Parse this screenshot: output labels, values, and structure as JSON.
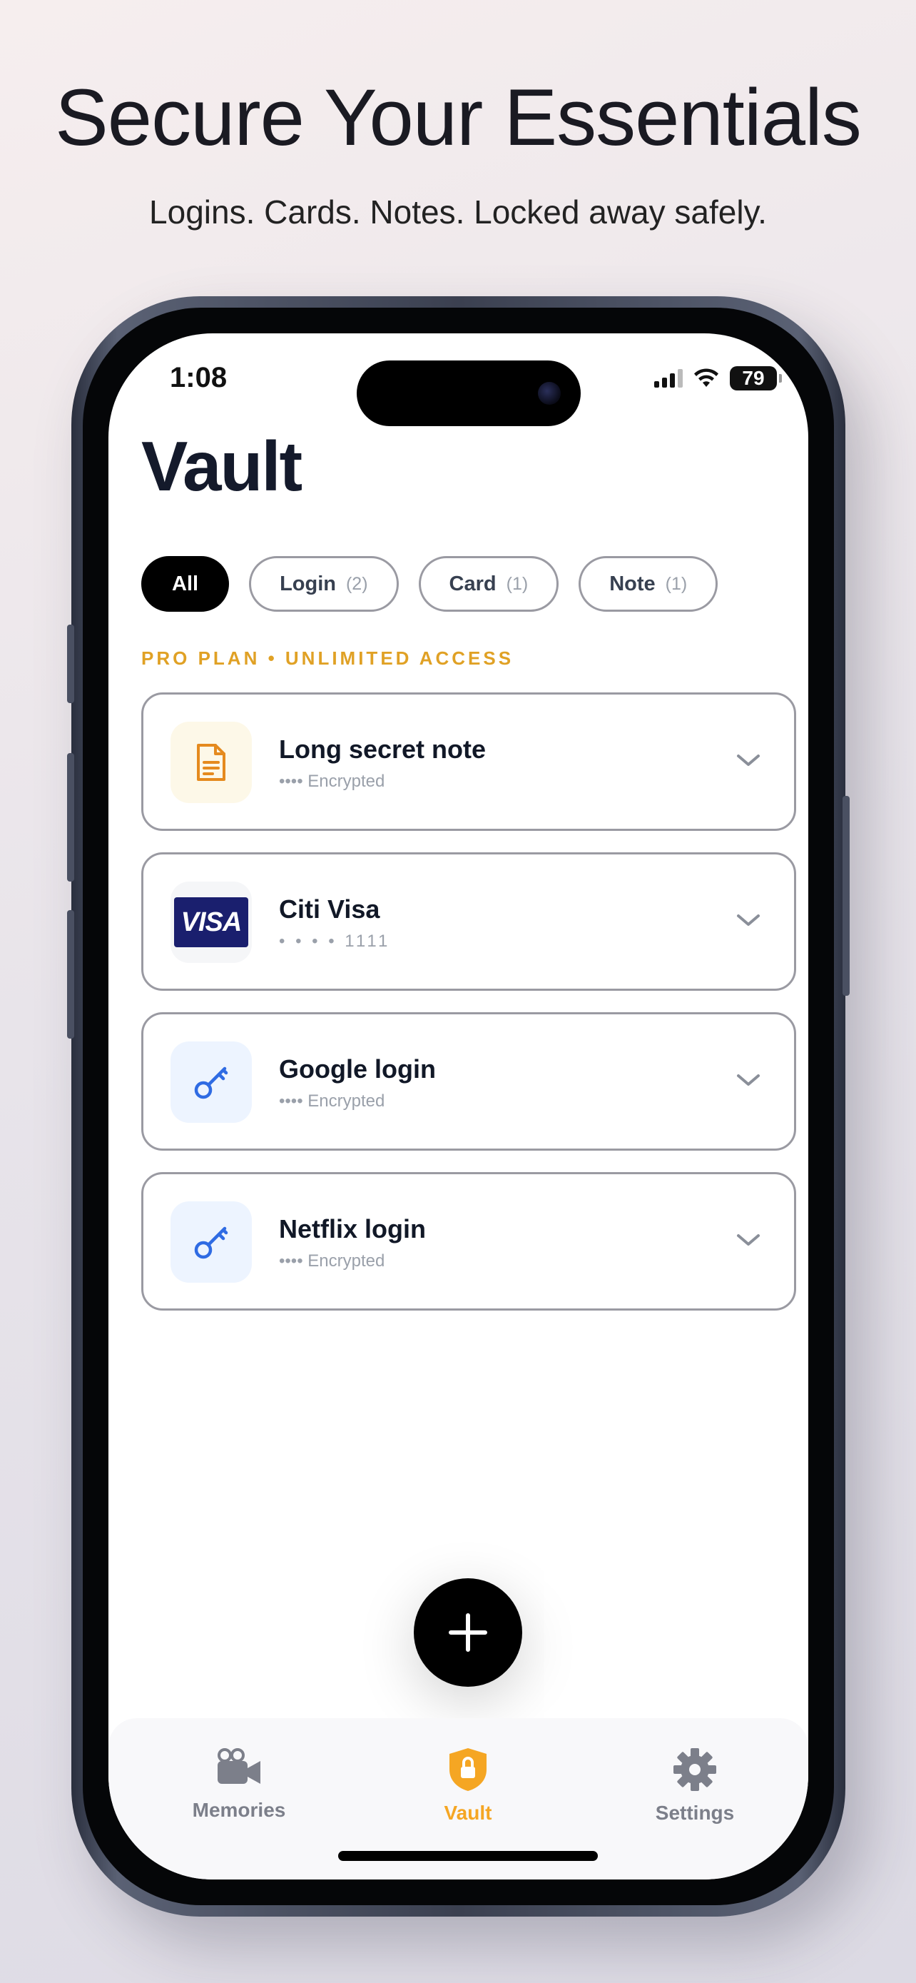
{
  "hero": {
    "headline": "Secure Your Essentials",
    "subhead": "Logins. Cards. Notes. Locked away safely."
  },
  "status_bar": {
    "time": "1:08",
    "battery": "79"
  },
  "screen": {
    "title": "Vault",
    "filters": [
      {
        "label": "All",
        "count": "",
        "active": true
      },
      {
        "label": "Login",
        "count": "(2)",
        "active": false
      },
      {
        "label": "Card",
        "count": "(1)",
        "active": false
      },
      {
        "label": "Note",
        "count": "(1)",
        "active": false
      }
    ],
    "plan_label": "PRO PLAN • UNLIMITED ACCESS",
    "items": [
      {
        "title": "Long secret note",
        "subtitle": "•••• Encrypted",
        "icon": "note-icon"
      },
      {
        "title": "Citi Visa",
        "subtitle": "• • • •  1111",
        "icon": "visa-card-icon",
        "card_brand": "VISA"
      },
      {
        "title": "Google login",
        "subtitle": "•••• Encrypted",
        "icon": "key-icon"
      },
      {
        "title": "Netflix login",
        "subtitle": "•••• Encrypted",
        "icon": "key-icon"
      }
    ]
  },
  "tab_bar": {
    "tabs": [
      {
        "label": "Memories",
        "icon": "video-camera-icon",
        "active": false
      },
      {
        "label": "Vault",
        "icon": "shield-lock-icon",
        "active": true
      },
      {
        "label": "Settings",
        "icon": "gear-icon",
        "active": false
      }
    ]
  },
  "colors": {
    "accent": "#F5A623",
    "plan_text": "#E0A125",
    "inactive_tab": "#7C7F8A",
    "key_icon": "#2F6BE3",
    "note_icon": "#E58A1E",
    "visa_blue": "#1A1F6E"
  }
}
